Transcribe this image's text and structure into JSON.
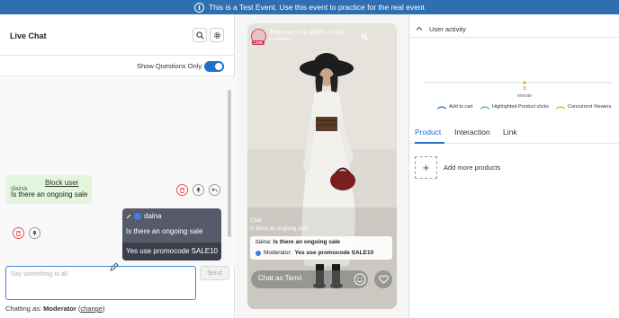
{
  "banner": {
    "icon": "info-icon",
    "icon_glyph": "i",
    "text": "This is a Test Event. Use this event to practice for the real event"
  },
  "live_chat": {
    "title": "Live Chat",
    "toggle_label": "Show Questions Only",
    "toggle_on": true,
    "messages": [
      {
        "user": "daina",
        "block_label": "Block user",
        "text": "Is there an ongoing sale"
      }
    ],
    "question": {
      "user": "daina",
      "text": "Is there an ongoing sale",
      "answer": "Yes use promocode SALE10"
    },
    "input_placeholder": "Say something to all",
    "send_label": "Send",
    "chatting_as_prefix": "Chatting as:",
    "chatting_as_role": "Moderator",
    "change_label": "change"
  },
  "preview": {
    "event_title": "Test event at 2025-10-16 ...",
    "viewers": "0 Viewers",
    "live_badge": "LIVE",
    "chat_label": "Chat",
    "question_label": "Is there an ongoing sale",
    "overlay_user": "daina:",
    "overlay_question": "Is there an ongoing sale",
    "overlay_mod": "Moderator:",
    "overlay_answer": "Yes use promocode SALE10",
    "input_placeholder": "Chat as Tanvi"
  },
  "user_activity": {
    "label": "User activity",
    "x_tick": "0",
    "x_label": "minute",
    "legend": [
      {
        "name": "Add to cart",
        "color": "#2f6fd0"
      },
      {
        "name": "Highlighted Product clicks",
        "color": "#38b8b0"
      },
      {
        "name": "Concurrent Viewers",
        "color": "#f0a030"
      }
    ]
  },
  "tabs": [
    {
      "label": "Product"
    },
    {
      "label": "Interaction"
    },
    {
      "label": "Link"
    }
  ],
  "products": {
    "add_label": "Add more products",
    "add_glyph": "+"
  },
  "colors": {
    "accent": "#1f6fd1",
    "banner": "#2d6fb0"
  }
}
